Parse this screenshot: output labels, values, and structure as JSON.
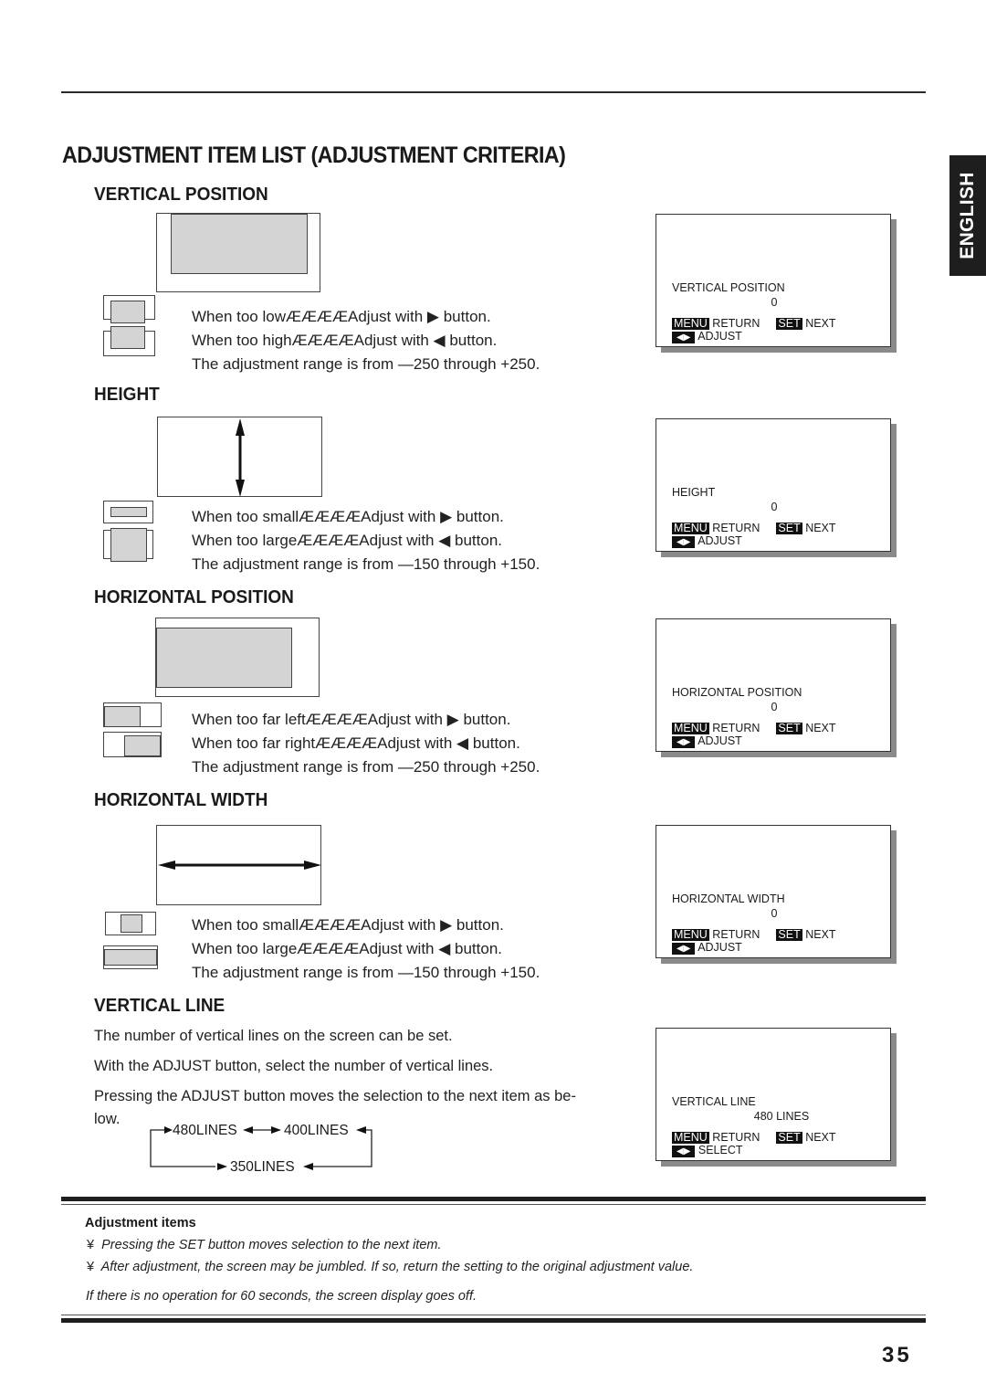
{
  "page": {
    "title": "ADJUSTMENT ITEM LIST (ADJUSTMENT CRITERIA)",
    "language_tab": "ENGLISH",
    "page_number": "35"
  },
  "sections": [
    {
      "title": "VERTICAL POSITION",
      "lines": [
        "When too lowÆÆÆÆAdjust with ▶ button.",
        "When too highÆÆÆÆAdjust with ◀ button.",
        "The adjustment range is from —250 through +250."
      ],
      "osd": {
        "label": "VERTICAL POSITION",
        "value": "0",
        "menu": "MENU",
        "return": "RETURN",
        "set": "SET",
        "next": "NEXT",
        "arrows": "◀▶",
        "action": "ADJUST"
      }
    },
    {
      "title": "HEIGHT",
      "lines": [
        "When too smallÆÆÆÆAdjust with ▶ button.",
        "When too largeÆÆÆÆAdjust with ◀ button.",
        "The adjustment range is from —150 through +150."
      ],
      "osd": {
        "label": "HEIGHT",
        "value": "0",
        "menu": "MENU",
        "return": "RETURN",
        "set": "SET",
        "next": "NEXT",
        "arrows": "◀▶",
        "action": "ADJUST"
      }
    },
    {
      "title": "HORIZONTAL POSITION",
      "lines": [
        "When too far leftÆÆÆÆAdjust with ▶ button.",
        "When too far rightÆÆÆÆAdjust with ◀ button.",
        "The adjustment range is from —250 through +250."
      ],
      "osd": {
        "label": "HORIZONTAL POSITION",
        "value": "0",
        "menu": "MENU",
        "return": "RETURN",
        "set": "SET",
        "next": "NEXT",
        "arrows": "◀▶",
        "action": "ADJUST"
      }
    },
    {
      "title": "HORIZONTAL WIDTH",
      "lines": [
        "When too smallÆÆÆÆAdjust with ▶ button.",
        "When too largeÆÆÆÆAdjust with ◀ button.",
        "The adjustment range is from —150 through +150."
      ],
      "osd": {
        "label": "HORIZONTAL WIDTH",
        "value": "0",
        "menu": "MENU",
        "return": "RETURN",
        "set": "SET",
        "next": "NEXT",
        "arrows": "◀▶",
        "action": "ADJUST"
      }
    },
    {
      "title": "VERTICAL LINE",
      "paragraphs": [
        "The number of vertical lines on the screen can be set.",
        "With the ADJUST button, select the number of vertical lines.",
        "Pressing the ADJUST button moves the selection to the next item as be-",
        "low."
      ],
      "flow": [
        "480LINES",
        "400LINES",
        "350LINES"
      ],
      "osd": {
        "label": "VERTICAL LINE",
        "value": "480 LINES",
        "menu": "MENU",
        "return": "RETURN",
        "set": "SET",
        "next": "NEXT",
        "arrows": "◀▶",
        "action": "SELECT"
      }
    }
  ],
  "notes": {
    "title": "Adjustment items",
    "bullet": "¥",
    "items": [
      "Pressing the SET button moves selection to the next item.",
      "After adjustment, the screen may be jumbled. If so, return the setting to the original adjustment value."
    ],
    "footer": "If there is no operation for 60 seconds, the screen display goes off."
  }
}
